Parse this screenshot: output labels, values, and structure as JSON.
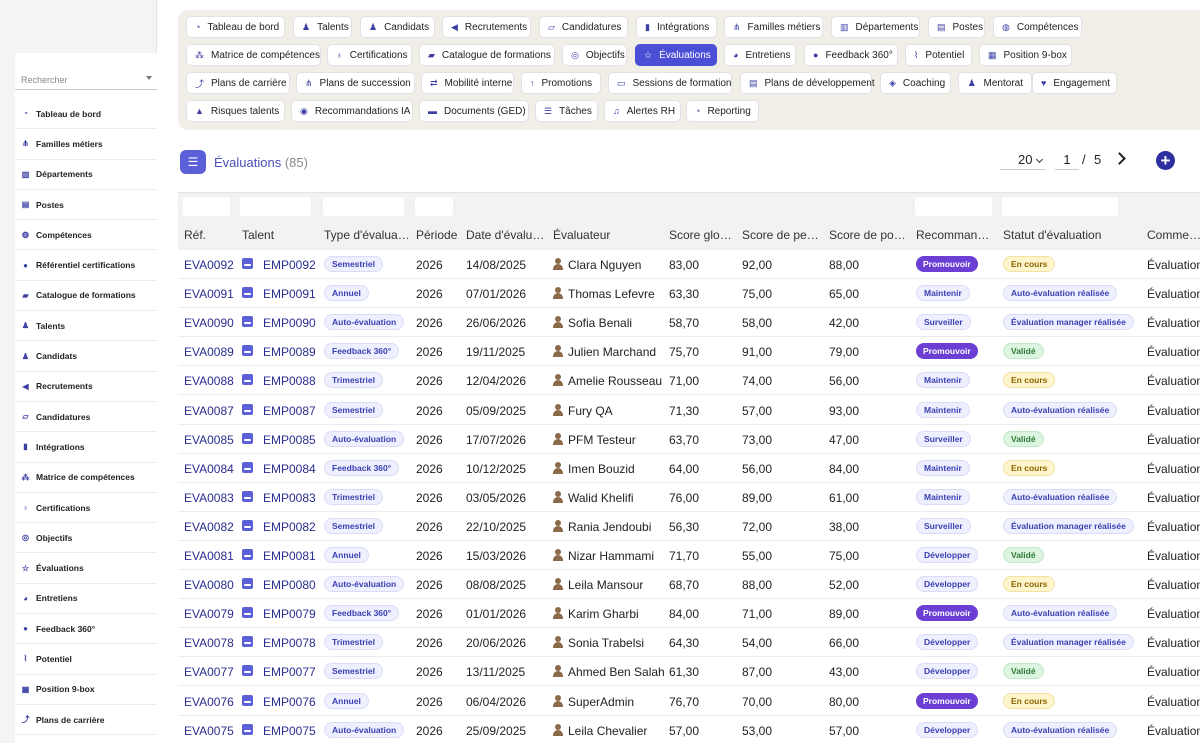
{
  "sidebar": {
    "search_placeholder": "Rechercher",
    "items": [
      {
        "label": "Tableau de bord",
        "icon": "dashboard-icon",
        "glyph": "◔"
      },
      {
        "label": "Familles métiers",
        "icon": "sitemap-icon",
        "glyph": "⋔"
      },
      {
        "label": "Départements",
        "icon": "building-icon",
        "glyph": "▥"
      },
      {
        "label": "Postes",
        "icon": "badge-icon",
        "glyph": "▤"
      },
      {
        "label": "Compétences",
        "icon": "brain-icon",
        "glyph": "◍"
      },
      {
        "label": "Référentiel certifications",
        "icon": "certificate-icon",
        "glyph": "●"
      },
      {
        "label": "Catalogue de formations",
        "icon": "graduation-cap-icon",
        "glyph": "▰"
      },
      {
        "label": "Talents",
        "icon": "user-icon",
        "glyph": "♟"
      },
      {
        "label": "Candidats",
        "icon": "user-plus-icon",
        "glyph": "♟"
      },
      {
        "label": "Recrutements",
        "icon": "megaphone-icon",
        "glyph": "◀"
      },
      {
        "label": "Candidatures",
        "icon": "file-edit-icon",
        "glyph": "▱"
      },
      {
        "label": "Intégrations",
        "icon": "door-icon",
        "glyph": "▮"
      },
      {
        "label": "Matrice de compétences",
        "icon": "grid-network-icon",
        "glyph": "⁂"
      },
      {
        "label": "Certifications",
        "icon": "ribbon-icon",
        "glyph": "♁"
      },
      {
        "label": "Objectifs",
        "icon": "target-icon",
        "glyph": "◎"
      },
      {
        "label": "Évaluations",
        "icon": "star-edit-icon",
        "glyph": "☆"
      },
      {
        "label": "Entretiens",
        "icon": "chat-icon",
        "glyph": "◕"
      },
      {
        "label": "Feedback 360°",
        "icon": "comment-icon",
        "glyph": "●"
      },
      {
        "label": "Potentiel",
        "icon": "chart-line-icon",
        "glyph": "⌇"
      },
      {
        "label": "Position 9-box",
        "icon": "nine-grid-icon",
        "glyph": "▦"
      },
      {
        "label": "Plans de carrière",
        "icon": "route-icon",
        "glyph": "⤴"
      }
    ]
  },
  "topnav": [
    {
      "label": "Tableau de bord",
      "icon": "dashboard-icon",
      "glyph": "◔"
    },
    {
      "label": "Talents",
      "icon": "user-icon",
      "glyph": "♟"
    },
    {
      "label": "Candidats",
      "icon": "user-plus-icon",
      "glyph": "♟"
    },
    {
      "label": "Recrutements",
      "icon": "megaphone-icon",
      "glyph": "◀"
    },
    {
      "label": "Candidatures",
      "icon": "file-edit-icon",
      "glyph": "▱"
    },
    {
      "label": "Intégrations",
      "icon": "door-icon",
      "glyph": "▮"
    },
    {
      "label": "Familles métiers",
      "icon": "sitemap-icon",
      "glyph": "⋔"
    },
    {
      "label": "Départements",
      "icon": "building-icon",
      "glyph": "▥"
    },
    {
      "label": "Postes",
      "icon": "badge-icon",
      "glyph": "▤"
    },
    {
      "label": "Compétences",
      "icon": "brain-icon",
      "glyph": "◍"
    },
    {
      "label": "Matrice de compétences",
      "icon": "grid-network-icon",
      "glyph": "⁂"
    },
    {
      "label": "Certifications",
      "icon": "ribbon-icon",
      "glyph": "♁"
    },
    {
      "label": "Catalogue de formations",
      "icon": "graduation-cap-icon",
      "glyph": "▰"
    },
    {
      "label": "Objectifs",
      "icon": "target-icon",
      "glyph": "◎"
    },
    {
      "label": "Évaluations",
      "icon": "star-edit-icon",
      "glyph": "☆",
      "active": true
    },
    {
      "label": "Entretiens",
      "icon": "chat-icon",
      "glyph": "◕"
    },
    {
      "label": "Feedback 360°",
      "icon": "comment-icon",
      "glyph": "●"
    },
    {
      "label": "Potentiel",
      "icon": "chart-line-icon",
      "glyph": "⌇"
    },
    {
      "label": "Position 9-box",
      "icon": "nine-grid-icon",
      "glyph": "▦"
    },
    {
      "label": "Plans de carrière",
      "icon": "route-icon",
      "glyph": "⤴"
    },
    {
      "label": "Plans de succession",
      "icon": "sitemap-icon",
      "glyph": "⋔"
    },
    {
      "label": "Mobilité interne",
      "icon": "exchange-icon",
      "glyph": "⇄"
    },
    {
      "label": "Promotions",
      "icon": "arrow-up-icon",
      "glyph": "↑"
    },
    {
      "label": "Sessions de formation",
      "icon": "presentation-icon",
      "glyph": "▭"
    },
    {
      "label": "Plans de développement",
      "icon": "clipboard-icon",
      "glyph": "▤"
    },
    {
      "label": "Coaching",
      "icon": "handshake-icon",
      "glyph": "◈"
    },
    {
      "label": "Mentorat",
      "icon": "mentor-icon",
      "glyph": "♟"
    },
    {
      "label": "Engagement",
      "icon": "heart-icon",
      "glyph": "♥"
    },
    {
      "label": "Risques talents",
      "icon": "warning-icon",
      "glyph": "▲"
    },
    {
      "label": "Recommandations IA",
      "icon": "robot-icon",
      "glyph": "◉"
    },
    {
      "label": "Documents (GED)",
      "icon": "folder-icon",
      "glyph": "▬"
    },
    {
      "label": "Tâches",
      "icon": "tasks-icon",
      "glyph": "☰"
    },
    {
      "label": "Alertes RH",
      "icon": "bell-icon",
      "glyph": "♫"
    },
    {
      "label": "Reporting",
      "icon": "pie-chart-icon",
      "glyph": "◔"
    }
  ],
  "header": {
    "title": "Évaluations",
    "count": "(85)",
    "page_size": "20",
    "page": "1",
    "separator": "/",
    "total_pages": "5",
    "add_label": "+"
  },
  "table": {
    "columns": [
      "Réf.",
      "Talent",
      "Type d'évaluation",
      "Période",
      "Date d'évaluation",
      "Évaluateur",
      "Score global",
      "Score de performance",
      "Score de potentiel",
      "Recommandation",
      "Statut d'évaluation",
      "Commentaire"
    ],
    "rows": [
      [
        "EVA0092",
        "EMP0092",
        "Semestriel",
        "2026",
        "14/08/2025",
        "Clara Nguyen",
        "83,00",
        "92,00",
        "88,00",
        "Promouvoir",
        "En cours",
        "Évaluation"
      ],
      [
        "EVA0091",
        "EMP0091",
        "Annuel",
        "2026",
        "07/01/2026",
        "Thomas Lefevre",
        "63,30",
        "75,00",
        "65,00",
        "Maintenir",
        "Auto-évaluation réalisée",
        "Évaluation"
      ],
      [
        "EVA0090",
        "EMP0090",
        "Auto-évaluation",
        "2026",
        "26/06/2026",
        "Sofia Benali",
        "58,70",
        "58,00",
        "42,00",
        "Surveiller",
        "Évaluation manager réalisée",
        "Évaluation"
      ],
      [
        "EVA0089",
        "EMP0089",
        "Feedback 360°",
        "2026",
        "19/11/2025",
        "Julien Marchand",
        "75,70",
        "91,00",
        "79,00",
        "Promouvoir",
        "Validé",
        "Évaluation"
      ],
      [
        "EVA0088",
        "EMP0088",
        "Trimestriel",
        "2026",
        "12/04/2026",
        "Amelie Rousseau",
        "71,00",
        "74,00",
        "56,00",
        "Maintenir",
        "En cours",
        "Évaluation"
      ],
      [
        "EVA0087",
        "EMP0087",
        "Semestriel",
        "2026",
        "05/09/2025",
        "Fury QA",
        "71,30",
        "57,00",
        "93,00",
        "Maintenir",
        "Auto-évaluation réalisée",
        "Évaluation"
      ],
      [
        "EVA0085",
        "EMP0085",
        "Auto-évaluation",
        "2026",
        "17/07/2026",
        "PFM Testeur",
        "63,70",
        "73,00",
        "47,00",
        "Surveiller",
        "Validé",
        "Évaluation"
      ],
      [
        "EVA0084",
        "EMP0084",
        "Feedback 360°",
        "2026",
        "10/12/2025",
        "Imen Bouzid",
        "64,00",
        "56,00",
        "84,00",
        "Maintenir",
        "En cours",
        "Évaluation"
      ],
      [
        "EVA0083",
        "EMP0083",
        "Trimestriel",
        "2026",
        "03/05/2026",
        "Walid Khelifi",
        "76,00",
        "89,00",
        "61,00",
        "Maintenir",
        "Auto-évaluation réalisée",
        "Évaluation"
      ],
      [
        "EVA0082",
        "EMP0082",
        "Semestriel",
        "2026",
        "22/10/2025",
        "Rania Jendoubi",
        "56,30",
        "72,00",
        "38,00",
        "Surveiller",
        "Évaluation manager réalisée",
        "Évaluation"
      ],
      [
        "EVA0081",
        "EMP0081",
        "Annuel",
        "2026",
        "15/03/2026",
        "Nizar Hammami",
        "71,70",
        "55,00",
        "75,00",
        "Développer",
        "Validé",
        "Évaluation"
      ],
      [
        "EVA0080",
        "EMP0080",
        "Auto-évaluation",
        "2026",
        "08/08/2025",
        "Leila Mansour",
        "68,70",
        "88,00",
        "52,00",
        "Développer",
        "En cours",
        "Évaluation"
      ],
      [
        "EVA0079",
        "EMP0079",
        "Feedback 360°",
        "2026",
        "01/01/2026",
        "Karim Gharbi",
        "84,00",
        "71,00",
        "89,00",
        "Promouvoir",
        "Auto-évaluation réalisée",
        "Évaluation"
      ],
      [
        "EVA0078",
        "EMP0078",
        "Trimestriel",
        "2026",
        "20/06/2026",
        "Sonia Trabelsi",
        "64,30",
        "54,00",
        "66,00",
        "Développer",
        "Évaluation manager réalisée",
        "Évaluation"
      ],
      [
        "EVA0077",
        "EMP0077",
        "Semestriel",
        "2026",
        "13/11/2025",
        "Ahmed Ben Salah",
        "61,30",
        "87,00",
        "43,00",
        "Développer",
        "Validé",
        "Évaluation"
      ],
      [
        "EVA0076",
        "EMP0076",
        "Annuel",
        "2026",
        "06/04/2026",
        "SuperAdmin",
        "76,70",
        "70,00",
        "80,00",
        "Promouvoir",
        "En cours",
        "Évaluation"
      ],
      [
        "EVA0075",
        "EMP0075",
        "Auto-évaluation",
        "2026",
        "25/09/2025",
        "Leila Chevalier",
        "57,00",
        "53,00",
        "57,00",
        "Développer",
        "Auto-évaluation réalisée",
        "Évaluation"
      ]
    ]
  },
  "colors": {
    "accent": "#4a4fd6",
    "promote": "#6b3fd4",
    "in_progress": "#fff5cc",
    "validated": "#ddf5e0"
  }
}
